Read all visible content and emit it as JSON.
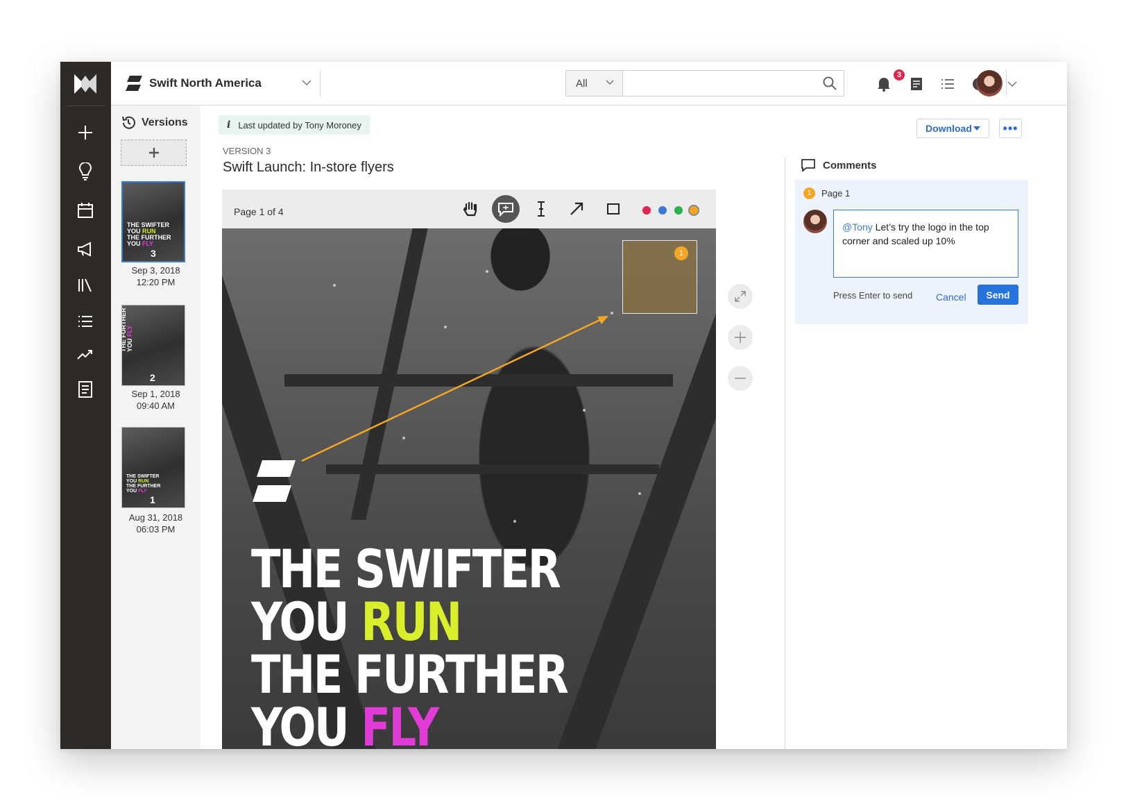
{
  "header": {
    "workspace_name": "Swift North America",
    "search_filter": "All",
    "search_placeholder": "",
    "notification_count": "3"
  },
  "versions": {
    "title": "Versions",
    "items": [
      {
        "number": "3",
        "date": "Sep 3, 2018",
        "time": "12:20 PM",
        "selected": true
      },
      {
        "number": "2",
        "date": "Sep 1, 2018",
        "time": "09:40 AM",
        "selected": false
      },
      {
        "number": "1",
        "date": "Aug 31, 2018",
        "time": "06:03 PM",
        "selected": false
      }
    ]
  },
  "document": {
    "info_text": "Last updated by Tony Moroney",
    "version_label": "VERSION 3",
    "title": "Swift Launch: In-store flyers",
    "download_label": "Download",
    "more_label": "•••",
    "page_indicator": "Page 1 of 4",
    "colors": [
      "#e0264f",
      "#3a7bd5",
      "#2bb24c",
      "#f5a623"
    ],
    "annotation_number": "1",
    "headline": {
      "line1": "THE SWIFTER",
      "line2_a": "YOU ",
      "line2_b": "RUN",
      "line3": "THE FURTHER",
      "line4_a": "YOU ",
      "line4_b": "FLY"
    },
    "thumb_text": {
      "l1": "THE SWIFTER",
      "l2a": "YOU ",
      "l2b": "RUN",
      "l3": "THE FURTHER",
      "l4a": "YOU ",
      "l4b": "FLY"
    }
  },
  "comments": {
    "title": "Comments",
    "page_label": "Page 1",
    "page_badge": "1",
    "mention": "@Tony",
    "draft_text": " Let’s try the logo in the top corner and scaled up 10%",
    "hint": "Press Enter to send",
    "cancel_label": "Cancel",
    "send_label": "Send"
  }
}
